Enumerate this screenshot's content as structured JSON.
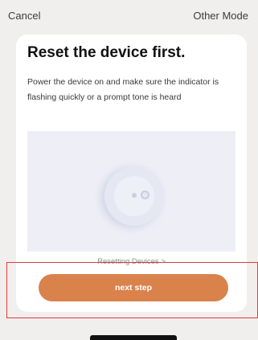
{
  "top_bar": {
    "cancel_label": "Cancel",
    "other_mode_label": "Other Mode"
  },
  "card": {
    "title": "Reset the device first.",
    "description": "Power the device on and make sure the indicator is flashing quickly or a prompt tone is heard",
    "resetting_link": "Resetting Devices >"
  },
  "actions": {
    "next_step_label": "next step"
  },
  "colors": {
    "accent": "#d9824c",
    "highlight": "#e03b3b",
    "background": "#f1efed"
  }
}
